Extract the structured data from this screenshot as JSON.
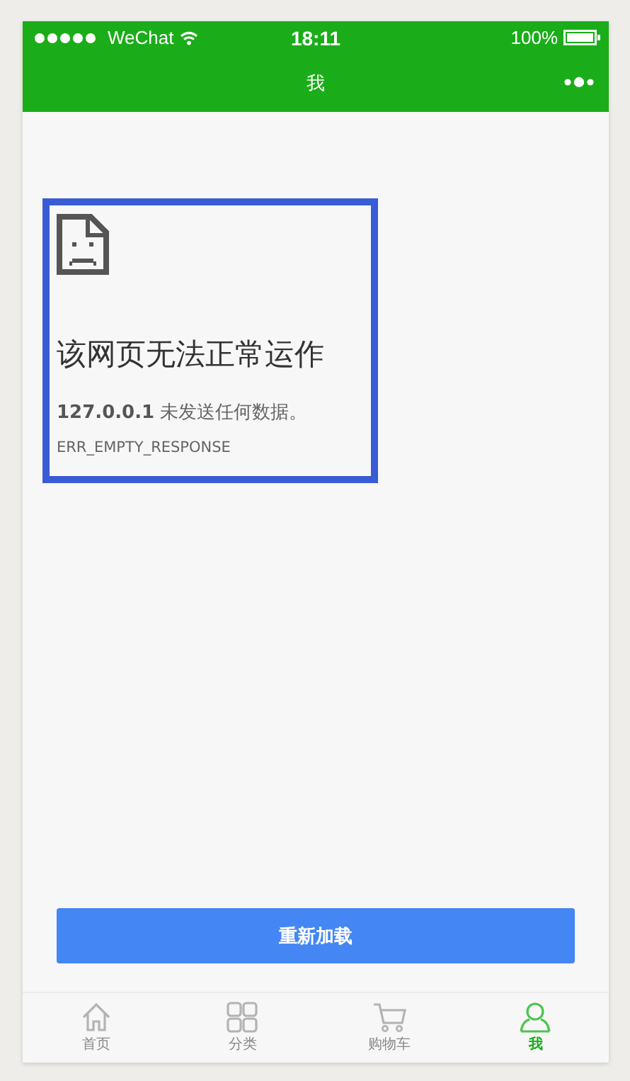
{
  "status_bar": {
    "carrier": "WeChat",
    "time": "18:11",
    "battery": "100%"
  },
  "nav_bar": {
    "title": "我"
  },
  "error": {
    "heading": "该网页无法正常运作",
    "message": "**127.0.0.1** 未发送任何数据。",
    "code": "ERR_EMPTY_RESPONSE"
  },
  "reload_button": "重新加载",
  "tabs": [
    {
      "kind": "home",
      "label": "首页",
      "selected": false
    },
    {
      "kind": "grid",
      "label": "分类",
      "selected": false
    },
    {
      "kind": "cart",
      "label": "购物车",
      "selected": false
    },
    {
      "kind": "person",
      "label": "我",
      "selected": true
    }
  ]
}
